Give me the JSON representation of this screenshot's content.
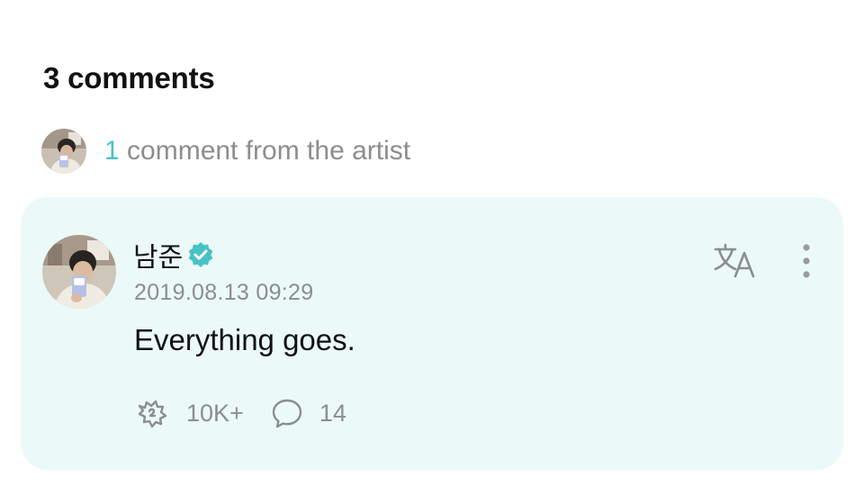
{
  "section": {
    "title": "3 comments"
  },
  "artist_summary": {
    "count": "1",
    "text": " comment from the artist"
  },
  "comment": {
    "author": "남준",
    "timestamp": "2019.08.13 09:29",
    "body": "Everything goes.",
    "reactions": "10K+",
    "replies": "14"
  },
  "icons": {
    "verified": "verified-badge-icon",
    "translate": "translate-icon",
    "more": "more-vertical-icon",
    "like": "like-icon",
    "reply": "comment-bubble-icon"
  },
  "colors": {
    "accent": "#48c2c6",
    "card_background": "#ebfaf8",
    "muted_text": "#8d8d8d",
    "primary_text": "#111111"
  }
}
